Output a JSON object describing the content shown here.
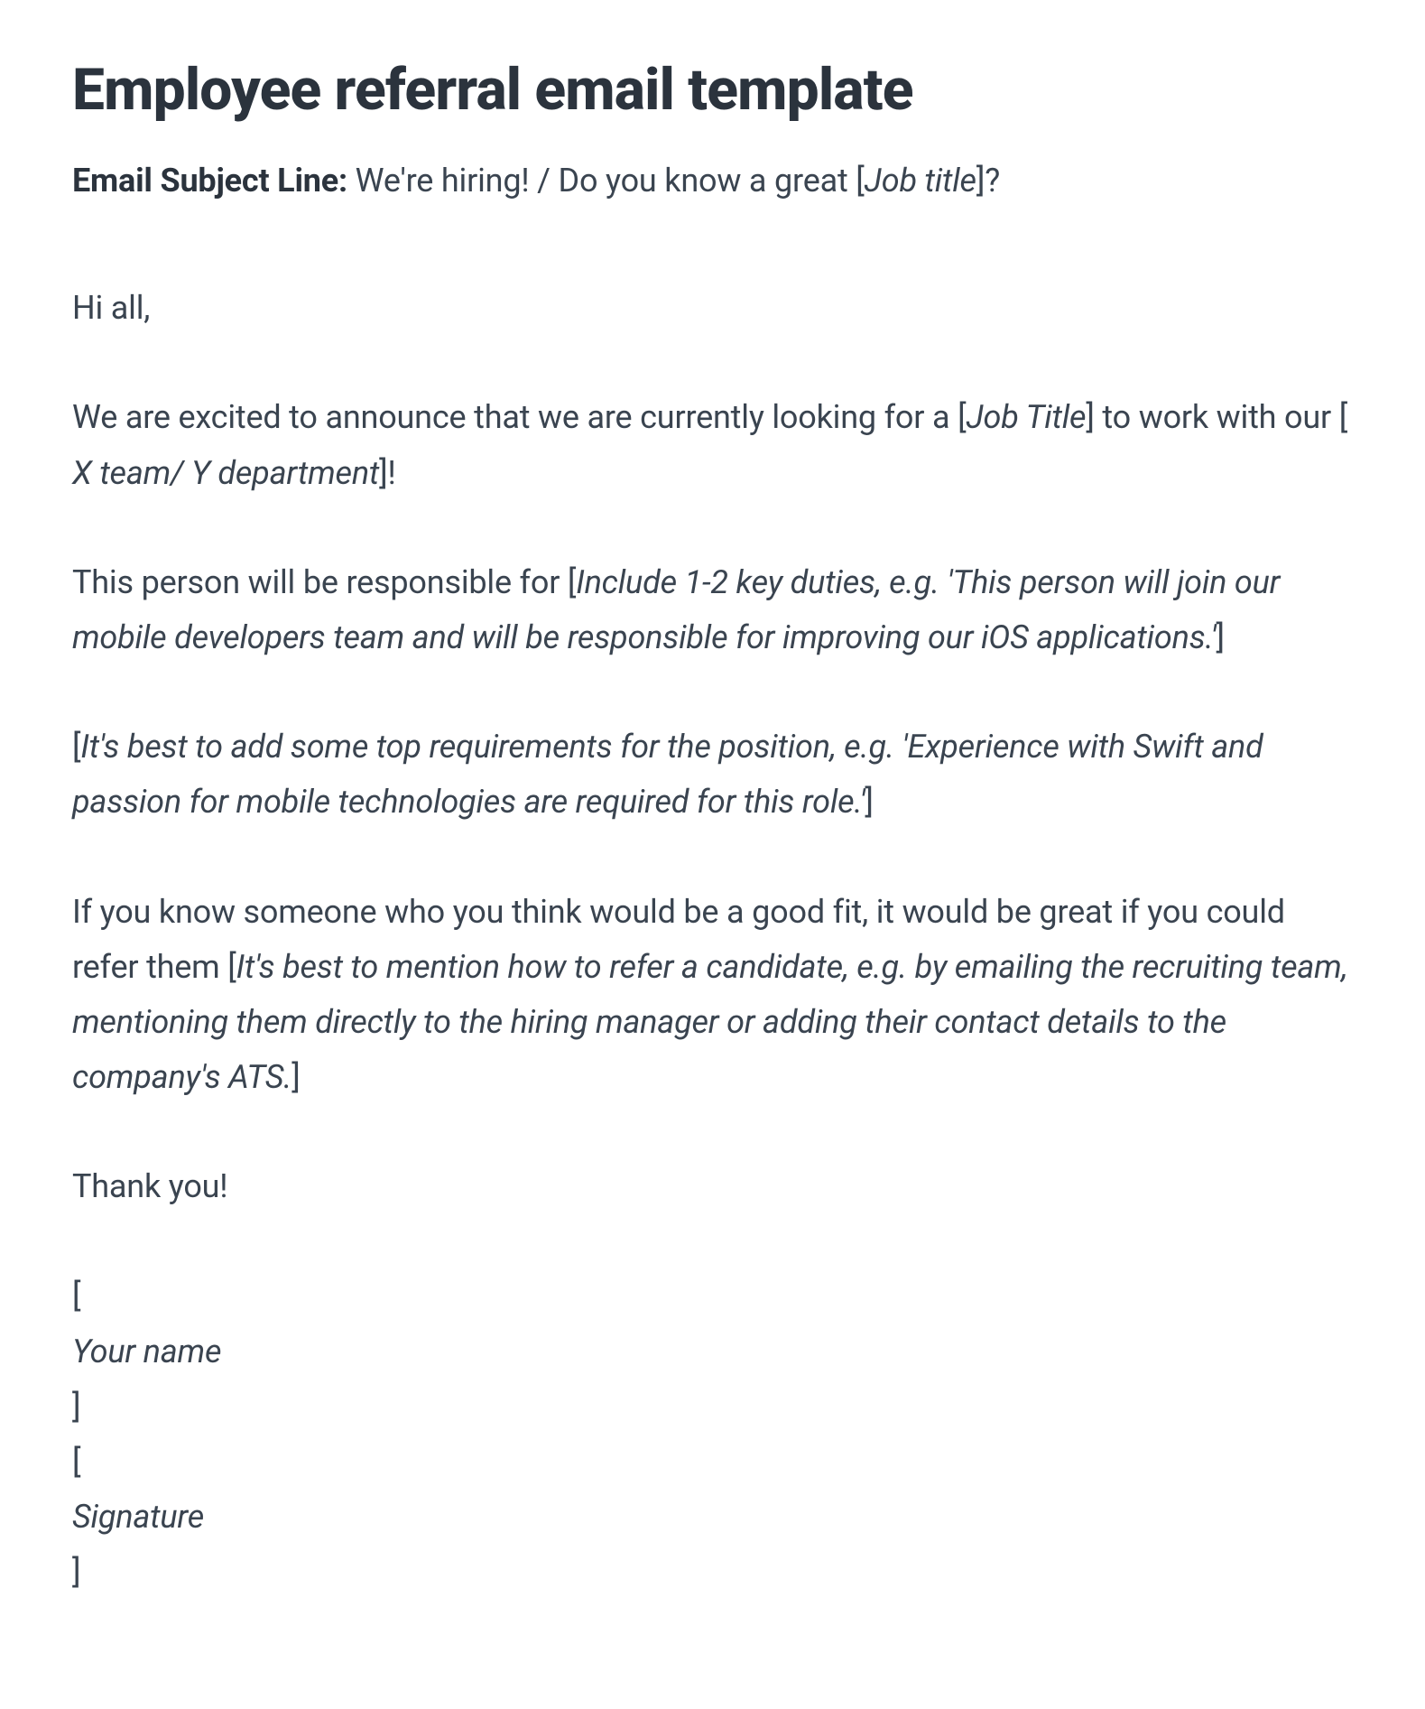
{
  "title": "Employee referral email template",
  "subject": {
    "label": "Email Subject Line:",
    "text_before": " We're hiring! / Do you know a great [",
    "placeholder": "Job title",
    "text_after": "]?"
  },
  "greeting": "Hi all,",
  "intro": {
    "before": "We are excited to announce that we are currently looking for a [",
    "ph1": "Job Title",
    "mid": "] to work with our [",
    "ph2": " X team/ Y department",
    "after": "]!"
  },
  "duties": {
    "before": "This person will be responsible for [",
    "ph": "Include 1-2 key duties, e.g. 'This person will join our mobile developers team and will be responsible for improving our iOS applications.'",
    "after": "]"
  },
  "requirements": {
    "before": "[",
    "ph": "It's best to add some top requirements for the position, e.g. 'Experience with Swift and passion for mobile technologies are required for this role.'",
    "after": "]"
  },
  "refer": {
    "before": "If you know someone who you think would be a good fit, it would be great if you could refer them [",
    "ph": "It's best to mention how to refer a candidate, e.g. by emailing the recruiting team, mentioning them directly to the hiring manager or adding their contact details to the company's ATS.",
    "after": "]"
  },
  "thanks": "Thank you!",
  "signature": {
    "name_before": "[",
    "name_ph": "Your name",
    "name_after": "]",
    "sig_before": "[",
    "sig_ph": "Signature",
    "sig_after": "]"
  }
}
